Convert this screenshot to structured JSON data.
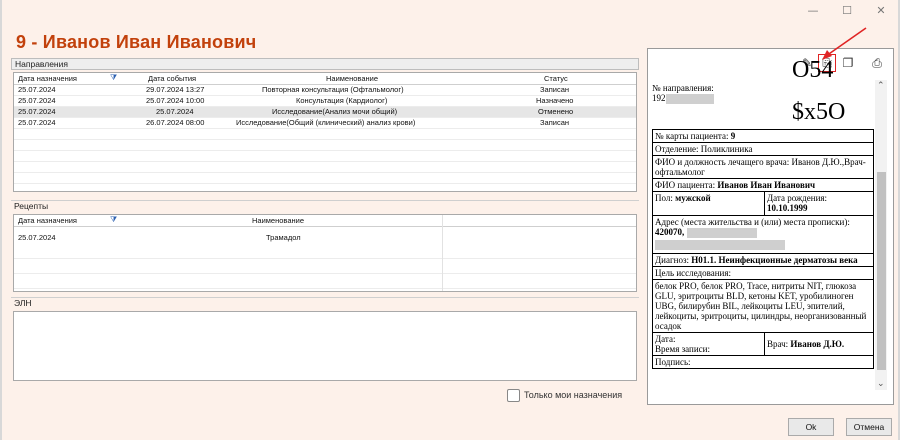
{
  "window": {
    "minimize": "—",
    "maximize": "☐",
    "close": "✕"
  },
  "title": "9 - Иванов Иван Иванович",
  "referrals": {
    "section_label": "Направления",
    "columns": [
      "Дата назначения",
      "Дата события",
      "Наименование",
      "Статус"
    ],
    "rows": [
      {
        "date": "25.07.2024",
        "event": "29.07.2024 13:27",
        "name": "Повторная консультация (Офтальмолог)",
        "status": "Записан"
      },
      {
        "date": "25.07.2024",
        "event": "25.07.2024 10:00",
        "name": "Консультация (Кардиолог)",
        "status": "Назначено"
      },
      {
        "date": "25.07.2024",
        "event": "25.07.2024",
        "name": "Исследование(Анализ мочи общий)",
        "status": "Отменено"
      },
      {
        "date": "25.07.2024",
        "event": "26.07.2024 08:00",
        "name": "Исследование(Общий (клинический) анализ крови)",
        "status": "Записан"
      }
    ]
  },
  "prescriptions": {
    "section_label": "Рецепты",
    "columns": [
      "Дата назначения",
      "Наименование"
    ],
    "rows": [
      {
        "date": "25.07.2024",
        "name": "Трамадол"
      }
    ]
  },
  "eln": {
    "section_label": "ЭЛН"
  },
  "only_mine_label": "Только мои назначения",
  "document": {
    "ref_no_label": "№ направления:",
    "ref_no_prefix": "192",
    "barcode_top": "O54",
    "barcode_main": "$x5O",
    "card_label": "№ карты пациента:",
    "card_value": "9",
    "department": "Отделение: Поликлиника",
    "doctor_full": "ФИО и должность лечащего врача: Иванов Д.Ю.,Врач-офтальмолог",
    "patient_label": "ФИО пациента:",
    "patient_value": "Иванов Иван Иванович",
    "sex_label": "Пол:",
    "sex_value": "мужской",
    "dob_label": "Дата рождения:",
    "dob_value": "10.10.1999",
    "address_label": "Адрес (места жительства и (или) места прописки):",
    "address_value": "420070,",
    "diagnosis_label": "Диагноз:",
    "diagnosis_value": "H01.1. Неинфекционные дерматозы века",
    "purpose_label": "Цель исследования:",
    "tests": "белок PRO, белок PRO, Trace, нитриты NIT, глюкоза GLU, эритроциты BLD, кетоны KET, уробилиноген UBG, билирубин BIL, лейкоциты LEU, эпителий, лейкоциты, эритроциты, цилиндры, неорганизованный осадок",
    "date_label": "Дата:",
    "time_label": "Время записи:",
    "doctor_label": "Врач:",
    "doctor_value": "Иванов Д.Ю.",
    "signature_label": "Подпись:"
  },
  "buttons": {
    "ok": "Ok",
    "cancel": "Отмена"
  },
  "icons": {
    "edit": "edit-document-icon",
    "export": "export-document-icon",
    "copy": "copy-document-icon",
    "print": "printer-icon"
  },
  "colors": {
    "title": "#c2410c",
    "annotation_arrow": "#e02424",
    "window_bg": "#fdf1ea"
  }
}
